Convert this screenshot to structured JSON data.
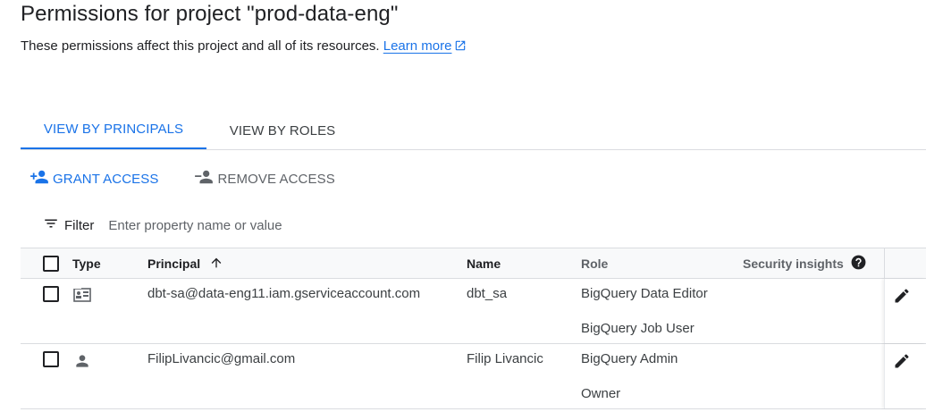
{
  "page": {
    "title": "Permissions for project \"prod-data-eng\"",
    "subtitle": "These permissions affect this project and all of its resources.",
    "learn_more": "Learn more"
  },
  "tabs": [
    {
      "label": "VIEW BY PRINCIPALS",
      "active": true
    },
    {
      "label": "VIEW BY ROLES",
      "active": false
    }
  ],
  "actions": {
    "grant": "GRANT ACCESS",
    "remove": "REMOVE ACCESS"
  },
  "filter": {
    "label": "Filter",
    "placeholder": "Enter property name or value"
  },
  "table": {
    "columns": {
      "type": "Type",
      "principal": "Principal",
      "name": "Name",
      "role": "Role",
      "security": "Security insights"
    },
    "rows": [
      {
        "type_icon": "service-account-icon",
        "principal": "dbt-sa@data-eng11.iam.gserviceaccount.com",
        "name": "dbt_sa",
        "roles": [
          "BigQuery Data Editor",
          "BigQuery Job User"
        ]
      },
      {
        "type_icon": "person-icon",
        "principal": "FilipLivancic@gmail.com",
        "name": "Filip Livancic",
        "roles": [
          "BigQuery Admin",
          "Owner"
        ]
      }
    ]
  },
  "colors": {
    "accent": "#1a73e8",
    "text": "#202124",
    "muted": "#5f6368",
    "border": "#dadce0"
  }
}
